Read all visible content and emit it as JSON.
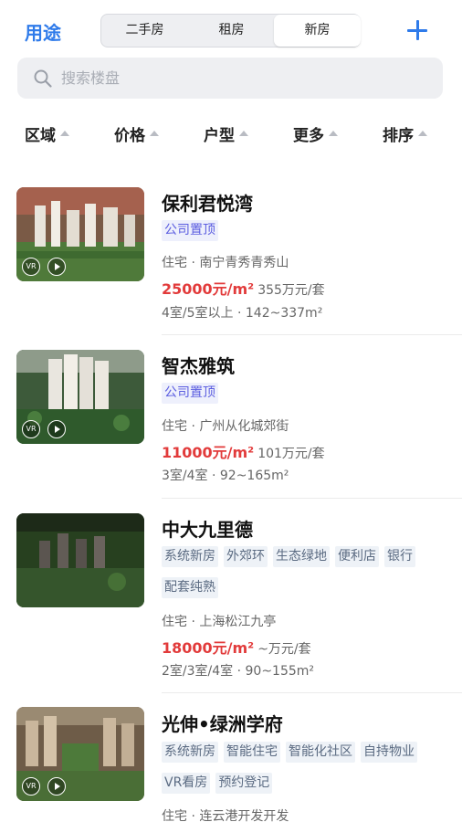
{
  "header": {
    "purpose_label": "用途",
    "segments": [
      "二手房",
      "租房",
      "新房"
    ],
    "selected_segment": "新房"
  },
  "search": {
    "placeholder": "搜索楼盘"
  },
  "filters": [
    "区域",
    "价格",
    "户型",
    "更多",
    "排序"
  ],
  "listings": [
    {
      "name": "保利君悦湾",
      "tags": [
        "公司置顶"
      ],
      "info": "住宅 · 南宁青秀青秀山",
      "price": "25000元/m²",
      "total": "355万元/套",
      "spec": "4室/5室以上 · 142~337m²",
      "has_vr": true
    },
    {
      "name": "智杰雅筑",
      "tags": [
        "公司置顶"
      ],
      "info": "住宅 · 广州从化城郊街",
      "price": "11000元/m²",
      "total": "101万元/套",
      "spec": "3室/4室 · 92~165m²",
      "has_vr": true
    },
    {
      "name": "中大九里德",
      "tags": [
        "系统新房",
        "外郊环",
        "生态绿地",
        "便利店",
        "银行",
        "配套纯熟"
      ],
      "info": "住宅 · 上海松江九亭",
      "price": "18000元/m²",
      "total": "~万元/套",
      "spec": "2室/3室/4室 · 90~155m²",
      "has_vr": false
    },
    {
      "name": "光伸•绿洲学府",
      "tags": [
        "系统新房",
        "智能住宅",
        "智能化社区",
        "自持物业",
        "VR看房",
        "预约登记"
      ],
      "info": "住宅 · 连云港开发开发",
      "has_vr": true
    }
  ],
  "vr_badge": "VR",
  "colors": {
    "accent": "#2f7bea",
    "price": "#e23b3b",
    "promo_tag": "#5b5de0"
  }
}
